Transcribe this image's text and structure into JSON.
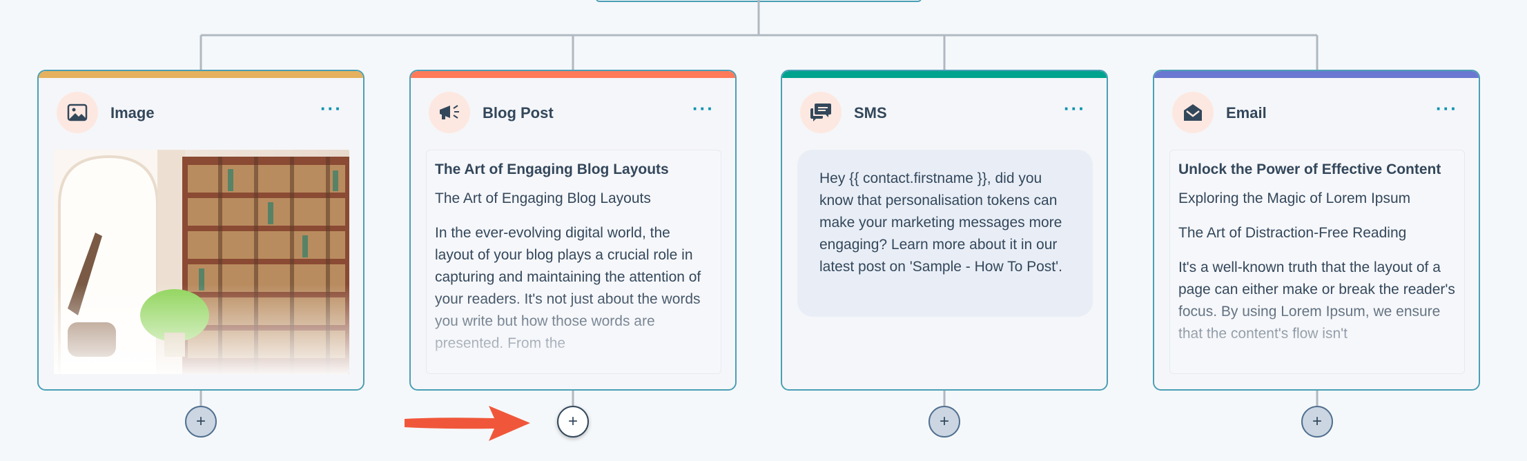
{
  "cards": [
    {
      "title": "Image",
      "menu": "···",
      "icon": "image-icon",
      "accent": "#e5b15e"
    },
    {
      "title": "Blog Post",
      "menu": "···",
      "icon": "megaphone-icon",
      "accent": "#ff7a59",
      "heading": "The Art of Engaging Blog Layouts",
      "subheading": "The Art of Engaging Blog Layouts",
      "body": "In the ever-evolving digital world, the layout of your blog plays a crucial role in capturing and maintaining the attention of your readers. It's not just about the words you write but how those words are presented. From the"
    },
    {
      "title": "SMS",
      "menu": "···",
      "icon": "chat-bubbles-icon",
      "accent": "#00a38d",
      "message": "Hey {{ contact.firstname }}, did you know that personalisation tokens can make your marketing messages more engaging? Learn more about it in our latest post on 'Sample - How To Post'."
    },
    {
      "title": "Email",
      "menu": "···",
      "icon": "envelope-icon",
      "accent": "#6a78d1",
      "heading": "Unlock the Power of Effective Content",
      "subheading1": "Exploring the Magic of Lorem Ipsum",
      "subheading2": "The Art of Distraction-Free Reading",
      "body": "It's a well-known truth that the layout of a page can either make or break the reader's focus. By using Lorem Ipsum, we ensure that the content's flow isn't"
    }
  ],
  "add_buttons": [
    "+",
    "+",
    "+",
    "+"
  ],
  "colors": {
    "connector": "#b0b8c1",
    "card_border": "#4a9fb5",
    "arrow": "#f0573a"
  }
}
